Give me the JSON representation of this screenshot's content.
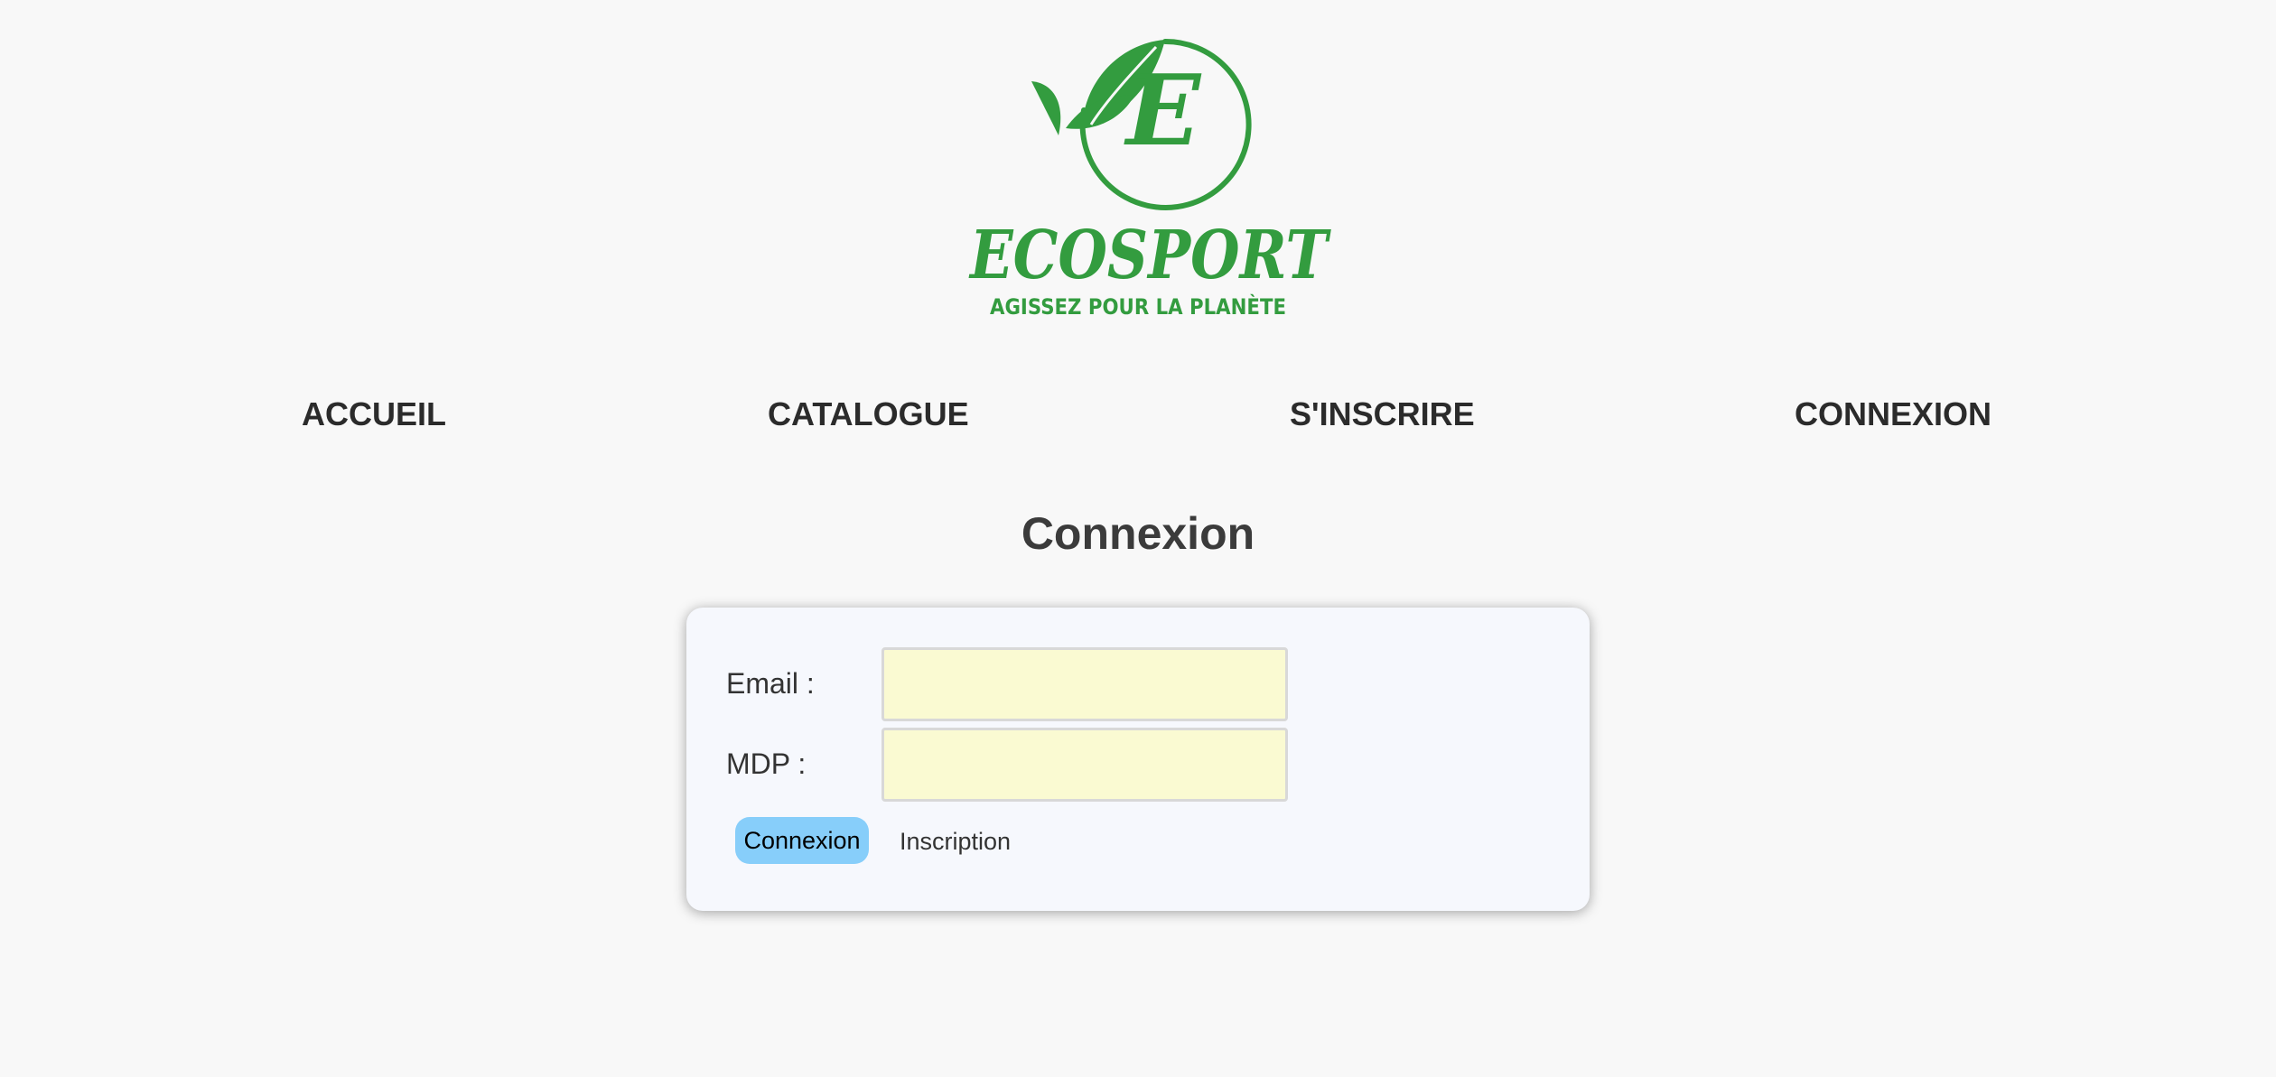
{
  "logo": {
    "letter": "E",
    "brand": "ECOSPORT",
    "tagline": "AGISSEZ POUR LA PLANÈTE",
    "color": "#339c3f",
    "icon": "leaf-icon"
  },
  "nav": {
    "items": [
      {
        "label": "ACCUEIL"
      },
      {
        "label": "CATALOGUE"
      },
      {
        "label": "S'INSCRIRE"
      },
      {
        "label": "CONNEXION"
      }
    ]
  },
  "page": {
    "title": "Connexion"
  },
  "form": {
    "email_label": "Email :",
    "email_value": "",
    "password_label": "MDP :",
    "password_value": "",
    "submit_label": "Connexion",
    "register_label": "Inscription"
  },
  "colors": {
    "background": "#f8f8f8",
    "card": "#f6f8fd",
    "input_fill": "#fafad2",
    "button": "#87cefa",
    "brand_green": "#339c3f"
  }
}
